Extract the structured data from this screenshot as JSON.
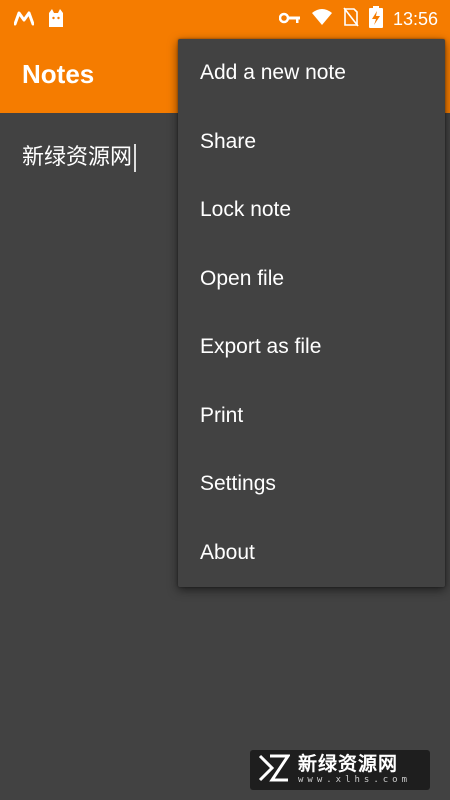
{
  "status_bar": {
    "time": "13:56",
    "left_icons": [
      "m-logo-icon",
      "cat-icon"
    ],
    "right_icons": [
      "key-icon",
      "wifi-icon",
      "no-sim-icon",
      "battery-charging-icon"
    ]
  },
  "app_bar": {
    "title": "Notes",
    "color": "#f57c00"
  },
  "editor": {
    "content": "新绿资源网"
  },
  "overflow_menu": {
    "items": [
      {
        "label": "Add a new note"
      },
      {
        "label": "Share"
      },
      {
        "label": "Lock note"
      },
      {
        "label": "Open file"
      },
      {
        "label": "Export as file"
      },
      {
        "label": "Print"
      },
      {
        "label": "Settings"
      },
      {
        "label": "About"
      }
    ]
  },
  "watermark": {
    "title": "新绿资源网",
    "url": "www.xlhs.com"
  },
  "colors": {
    "accent": "#f57c00",
    "background": "#424242",
    "menu_background": "#424242",
    "text": "#ffffff"
  }
}
